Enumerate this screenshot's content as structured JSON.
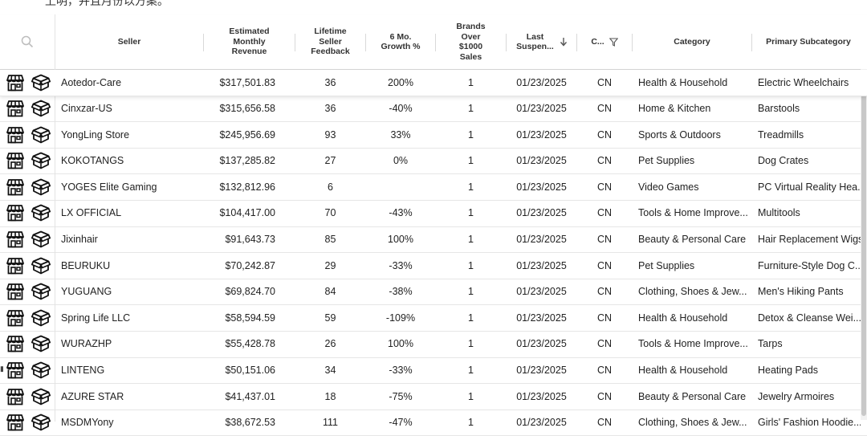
{
  "header_clip_text": "上明，并且月份以方案。",
  "columns": {
    "seller": "Seller",
    "revenue": "Estimated Monthly Revenue",
    "feedback": "Lifetime Seller Feedback",
    "growth": "6 Mo. Growth %",
    "brands": "Brands Over $1000 Sales",
    "suspended": "Last Suspen...",
    "country": "C...",
    "category": "Category",
    "subcategory": "Primary Subcategory"
  },
  "icons": {
    "search": "search-icon",
    "storefront": "storefront-icon",
    "package": "package-icon",
    "sort": "arrow-down-icon",
    "filter": "filter-icon"
  },
  "rows": [
    {
      "seller": "Aotedor-Care",
      "revenue": "$317,501.83",
      "feedback": "36",
      "growth": "200%",
      "brands": "1",
      "date": "01/23/2025",
      "country": "CN",
      "category": "Health & Household",
      "subcategory": "Electric Wheelchairs"
    },
    {
      "seller": "Cinxzar-US",
      "revenue": "$315,656.58",
      "feedback": "36",
      "growth": "-40%",
      "brands": "1",
      "date": "01/23/2025",
      "country": "CN",
      "category": "Home & Kitchen",
      "subcategory": "Barstools"
    },
    {
      "seller": "YongLing Store",
      "revenue": "$245,956.69",
      "feedback": "93",
      "growth": "33%",
      "brands": "1",
      "date": "01/23/2025",
      "country": "CN",
      "category": "Sports & Outdoors",
      "subcategory": "Treadmills"
    },
    {
      "seller": "KOKOTANGS",
      "revenue": "$137,285.82",
      "feedback": "27",
      "growth": "0%",
      "brands": "1",
      "date": "01/23/2025",
      "country": "CN",
      "category": "Pet Supplies",
      "subcategory": "Dog Crates"
    },
    {
      "seller": "YOGES Elite Gaming",
      "revenue": "$132,812.96",
      "feedback": "6",
      "growth": "",
      "brands": "1",
      "date": "01/23/2025",
      "country": "CN",
      "category": "Video Games",
      "subcategory": "PC Virtual Reality Hea..."
    },
    {
      "seller": "LX OFFICIAL",
      "revenue": "$104,417.00",
      "feedback": "70",
      "growth": "-43%",
      "brands": "1",
      "date": "01/23/2025",
      "country": "CN",
      "category": "Tools & Home Improve...",
      "subcategory": "Multitools"
    },
    {
      "seller": "Jixinhair",
      "revenue": "$91,643.73",
      "feedback": "85",
      "growth": "100%",
      "brands": "1",
      "date": "01/23/2025",
      "country": "CN",
      "category": "Beauty & Personal Care",
      "subcategory": "Hair Replacement Wigs"
    },
    {
      "seller": "BEURUKU",
      "revenue": "$70,242.87",
      "feedback": "29",
      "growth": "-33%",
      "brands": "1",
      "date": "01/23/2025",
      "country": "CN",
      "category": "Pet Supplies",
      "subcategory": "Furniture-Style Dog C..."
    },
    {
      "seller": "YUGUANG",
      "revenue": "$69,824.70",
      "feedback": "84",
      "growth": "-38%",
      "brands": "1",
      "date": "01/23/2025",
      "country": "CN",
      "category": "Clothing, Shoes & Jew...",
      "subcategory": "Men's Hiking Pants"
    },
    {
      "seller": "Spring Life LLC",
      "revenue": "$58,594.59",
      "feedback": "59",
      "growth": "-109%",
      "brands": "1",
      "date": "01/23/2025",
      "country": "CN",
      "category": "Health & Household",
      "subcategory": "Detox & Cleanse Wei..."
    },
    {
      "seller": "WURAZHP",
      "revenue": "$55,428.78",
      "feedback": "26",
      "growth": "100%",
      "brands": "1",
      "date": "01/23/2025",
      "country": "CN",
      "category": "Tools & Home Improve...",
      "subcategory": "Tarps"
    },
    {
      "seller": "LINTENG",
      "revenue": "$50,151.06",
      "feedback": "34",
      "growth": "-33%",
      "brands": "1",
      "date": "01/23/2025",
      "country": "CN",
      "category": "Health & Household",
      "subcategory": "Heating Pads"
    },
    {
      "seller": "AZURE STAR",
      "revenue": "$41,437.01",
      "feedback": "18",
      "growth": "-75%",
      "brands": "1",
      "date": "01/23/2025",
      "country": "CN",
      "category": "Beauty & Personal Care",
      "subcategory": "Jewelry Armoires"
    },
    {
      "seller": "MSDMYony",
      "revenue": "$38,672.53",
      "feedback": "111",
      "growth": "-47%",
      "brands": "1",
      "date": "01/23/2025",
      "country": "CN",
      "category": "Clothing, Shoes & Jew...",
      "subcategory": "Girls' Fashion Hoodie..."
    }
  ]
}
